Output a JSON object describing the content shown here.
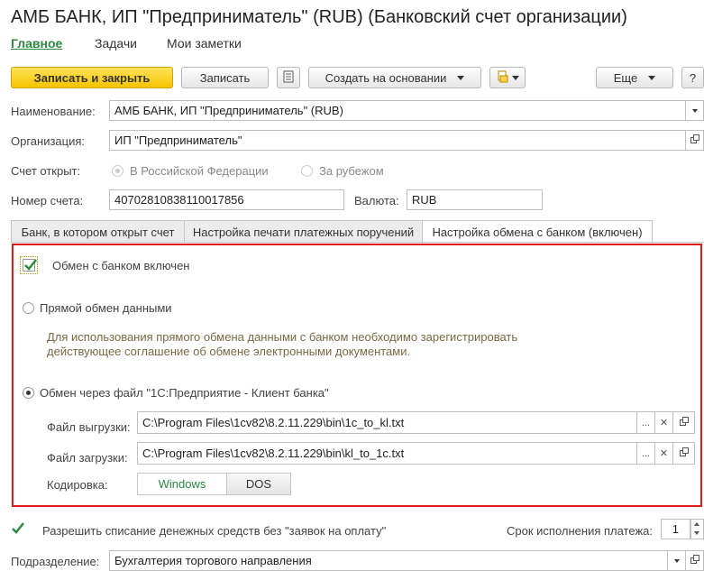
{
  "title": "АМБ БАНК, ИП \"Предприниматель\" (RUB) (Банковский счет организации)",
  "nav": [
    "Главное",
    "Задачи",
    "Мои заметки"
  ],
  "toolbar": {
    "save_close": "Записать и закрыть",
    "save": "Записать",
    "create_based": "Создать на основании",
    "more": "Еще",
    "help": "?"
  },
  "form": {
    "name_label": "Наименование:",
    "name_value": "АМБ БАНК, ИП \"Предприниматель\" (RUB)",
    "org_label": "Организация:",
    "org_value": "ИП \"Предприниматель\"",
    "opened_label": "Счет открыт:",
    "opened_options": [
      "В Российской Федерации",
      "За рубежом"
    ],
    "account_label": "Номер счета:",
    "account_value": "40702810838110017856",
    "currency_label": "Валюта:",
    "currency_value": "RUB"
  },
  "tabs": [
    "Банк, в котором открыт счет",
    "Настройка печати платежных поручений",
    "Настройка обмена с банком (включен)"
  ],
  "exchange": {
    "enabled_label": "Обмен с банком включен",
    "direct_label": "Прямой обмен данными",
    "direct_note": "Для использования прямого обмена данными с банком необходимо зарегистрировать действующее соглашение об обмене электронными документами.",
    "file_label": "Обмен через файл \"1С:Предприятие - Клиент банка\"",
    "export_label": "Файл выгрузки:",
    "export_value": "C:\\Program Files\\1cv82\\8.2.11.229\\bin\\1c_to_kl.txt",
    "import_label": "Файл загрузки:",
    "import_value": "C:\\Program Files\\1cv82\\8.2.11.229\\bin\\kl_to_1c.txt",
    "encoding_label": "Кодировка:",
    "encoding_options": [
      "Windows",
      "DOS"
    ],
    "selected_encoding": "Windows"
  },
  "bottom": {
    "allow_label": "Разрешить списание денежных средств без \"заявок на оплату\"",
    "term_label": "Срок исполнения платежа:",
    "term_value": "1",
    "dept_label": "Подразделение:",
    "dept_value": "Бухгалтерия торгового направления"
  },
  "colors": {
    "accent_green": "#2a8a3e",
    "primary_yellow": "#f5c400",
    "highlight_red": "#e01b1b"
  }
}
